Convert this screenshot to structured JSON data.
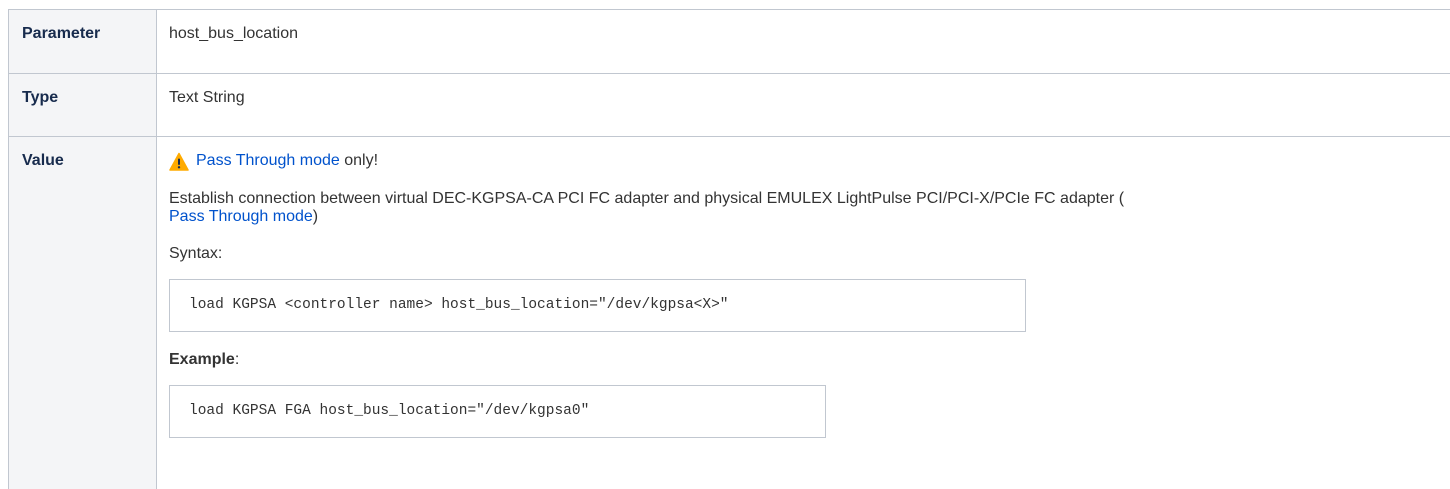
{
  "table": {
    "rows": {
      "parameter": {
        "label": "Parameter",
        "value": "host_bus_location"
      },
      "type": {
        "label": "Type",
        "value": "Text String"
      },
      "value": {
        "label": "Value"
      }
    }
  },
  "value_cell": {
    "warning_icon": "warning-triangle-icon",
    "warning_link": "Pass Through mode",
    "warning_suffix": " only!",
    "description_text": "Establish connection between virtual DEC-KGPSA-CA PCI FC adapter and physical EMULEX LightPulse PCI/PCI-X/PCIe FC adapter (",
    "description_link": "Pass Through mode",
    "description_suffix": ")",
    "syntax_label": "Syntax:",
    "syntax_code": "load KGPSA <controller name> host_bus_location=\"/dev/kgpsa<X>\"",
    "example_label": "Example",
    "example_colon": ":",
    "example_code": "load KGPSA FGA host_bus_location=\"/dev/kgpsa0\""
  },
  "colors": {
    "link": "#0052cc",
    "header_bg": "#f4f5f7",
    "border": "#c1c7d0",
    "warning_fill": "#ffab00"
  }
}
